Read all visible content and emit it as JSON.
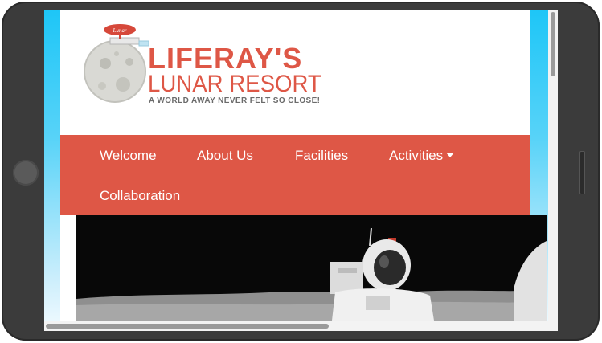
{
  "brand": {
    "title": "LIFERAY'S",
    "subtitle": "LUNAR RESORT",
    "tagline": "A WORLD AWAY NEVER FELT SO CLOSE!",
    "color": "#de5746"
  },
  "nav": {
    "color": "#de5746",
    "items": [
      {
        "label": "Welcome"
      },
      {
        "label": "About Us"
      },
      {
        "label": "Facilities"
      },
      {
        "label": "Activities",
        "icon": "caret-down-icon"
      },
      {
        "label": "Collaboration"
      }
    ]
  },
  "hero": {
    "description": "Astronaut on lunar surface"
  }
}
